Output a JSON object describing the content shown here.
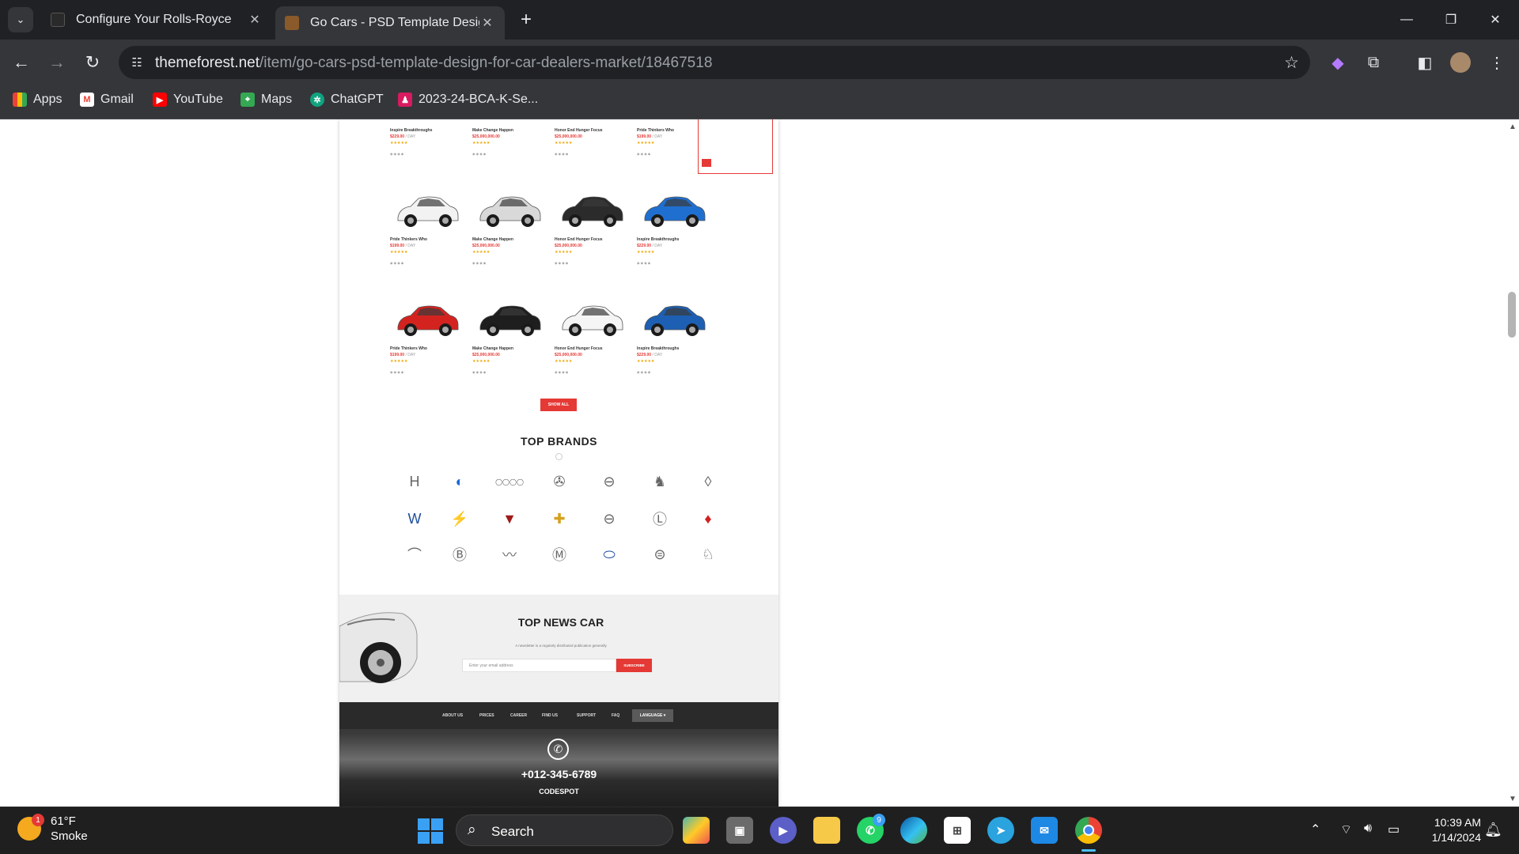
{
  "browser": {
    "tabs": [
      {
        "title": "Configure Your Rolls-Royce",
        "active": false
      },
      {
        "title": "Go Cars - PSD Template Design",
        "active": true
      }
    ],
    "url_host": "themeforest.net",
    "url_path": "/item/go-cars-psd-template-design-for-car-dealers-market/18467518",
    "bookmarks": [
      "Apps",
      "Gmail",
      "YouTube",
      "Maps",
      "ChatGPT",
      "2023-24-BCA-K-Se..."
    ]
  },
  "page": {
    "car_rows": [
      [
        {
          "name": "Inspire Breakthroughs",
          "price": "$229.00",
          "unit": " / DAY"
        },
        {
          "name": "Make Change Happen",
          "price": "$25,000,000.00",
          "unit": ""
        },
        {
          "name": "Honor End Hunger Focus",
          "price": "$25,000,000.00",
          "unit": ""
        },
        {
          "name": "Pride Thinkers Who",
          "price": "$199.00",
          "unit": " / DAY"
        }
      ],
      [
        {
          "name": "Pride Thinkers Who",
          "price": "$199.00",
          "unit": " / DAY"
        },
        {
          "name": "Make Change Happen",
          "price": "$25,000,000.00",
          "unit": ""
        },
        {
          "name": "Honor End Hunger Focus",
          "price": "$25,000,000.00",
          "unit": ""
        },
        {
          "name": "Inspire Breakthroughs",
          "price": "$229.00",
          "unit": " / DAY"
        }
      ],
      [
        {
          "name": "Pride Thinkers Who",
          "price": "$199.00",
          "unit": " / DAY"
        },
        {
          "name": "Make Change Happen",
          "price": "$25,000,000.00",
          "unit": ""
        },
        {
          "name": "Honor End Hunger Focus",
          "price": "$25,000,000.00",
          "unit": ""
        },
        {
          "name": "Inspire Breakthroughs",
          "price": "$229.00",
          "unit": " / DAY"
        }
      ]
    ],
    "car_colors": [
      "#f2f2f2",
      "#d9d9d9",
      "#2b2b2b",
      "#1f6fd1",
      "#d4231f",
      "#1e1e1e",
      "#f5f5f5",
      "#1d5fb3"
    ],
    "show_all_label": "SHOW ALL",
    "brands_title": "TOP BRANDS",
    "brands": [
      [
        "honda-logo-icon",
        "bmw-logo-icon",
        "audi-logo-icon",
        "mercedes-logo-icon",
        "volvo-logo-icon",
        "peugeot-logo-icon",
        "renault-logo-icon"
      ],
      [
        "volkswagen-logo-icon",
        "opel-logo-icon",
        "cadillac-logo-icon",
        "chevrolet-logo-icon",
        "nissan-logo-icon",
        "lexus-logo-icon",
        "mitsubishi-logo-icon"
      ],
      [
        "infiniti-logo-icon",
        "bentley-logo-icon",
        "jaguar-logo-icon",
        "mazda-logo-icon",
        "ford-logo-icon",
        "scion-logo-icon",
        "ferrari-logo-icon"
      ]
    ],
    "newsletter": {
      "title": "TOP NEWS CAR",
      "subtitle": "A newsletter is a regularly distributed publication generally",
      "placeholder": "Enter your email address",
      "button": "SUBSCRIBE"
    },
    "footer": {
      "nav": [
        "ABOUT US",
        "PRICES",
        "CAREER",
        "FIND US",
        "SUPPORT",
        "FAQ"
      ],
      "language": "LANGUAGE",
      "phone": "+012-345-6789",
      "brand": "CODESPOT"
    }
  },
  "taskbar": {
    "weather_temp": "61°F",
    "weather_desc": "Smoke",
    "weather_badge": "1",
    "search_label": "Search",
    "whatsapp_badge": "9",
    "time": "10:39 AM",
    "date": "1/14/2024"
  },
  "colors": {
    "accent_red": "#e53935",
    "chrome_dark": "#202124",
    "chrome_mid": "#35363a"
  }
}
